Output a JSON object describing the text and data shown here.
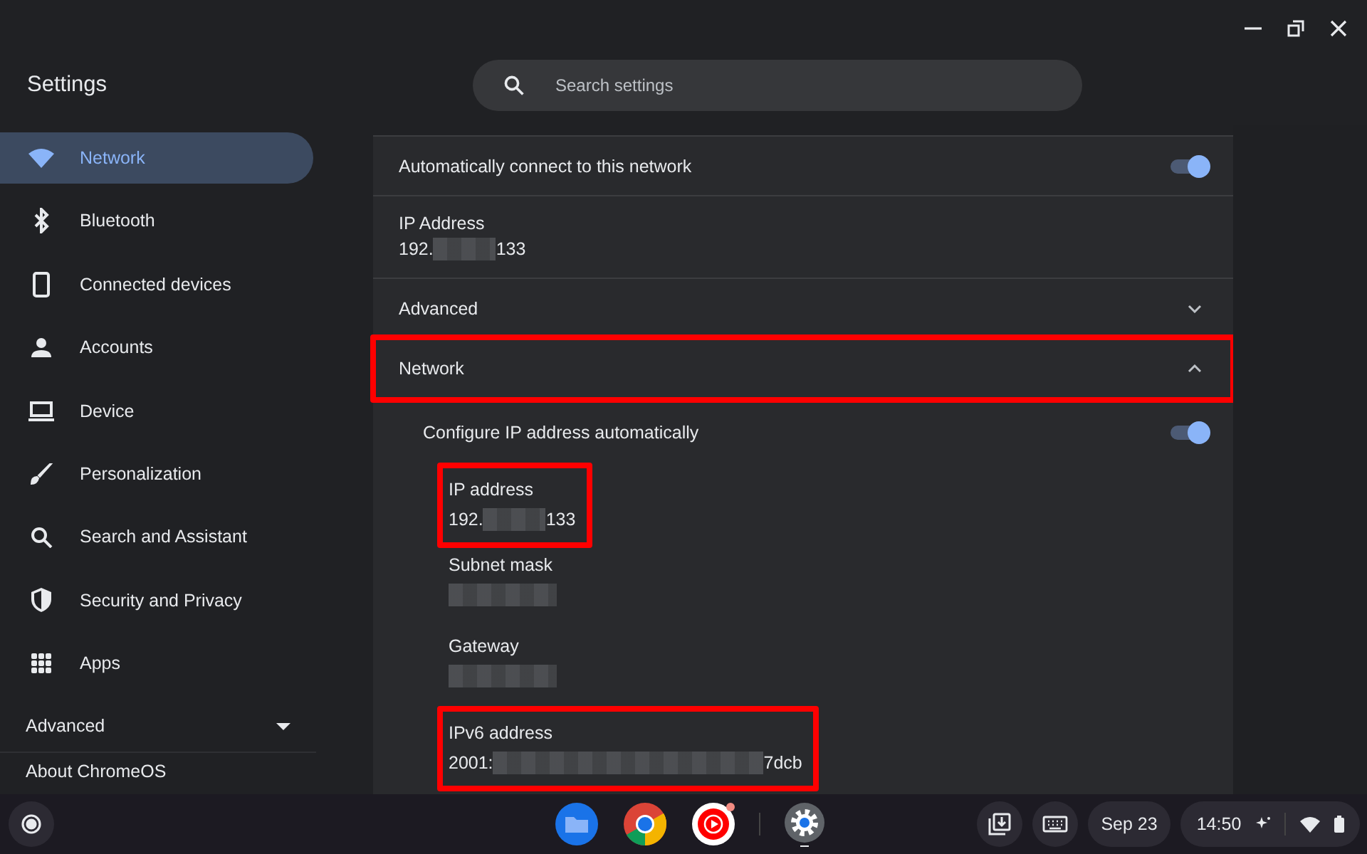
{
  "window": {
    "title": "Settings"
  },
  "search": {
    "placeholder": "Search settings"
  },
  "sidebar": {
    "items": [
      {
        "label": "Network",
        "selected": true
      },
      {
        "label": "Bluetooth",
        "selected": false
      },
      {
        "label": "Connected devices",
        "selected": false
      },
      {
        "label": "Accounts",
        "selected": false
      },
      {
        "label": "Device",
        "selected": false
      },
      {
        "label": "Personalization",
        "selected": false
      },
      {
        "label": "Search and Assistant",
        "selected": false
      },
      {
        "label": "Security and Privacy",
        "selected": false
      },
      {
        "label": "Apps",
        "selected": false
      }
    ],
    "advanced": {
      "label": "Advanced",
      "expanded": false
    },
    "about": "About ChromeOS"
  },
  "content": {
    "rows": [
      {
        "kind": "toggle",
        "label": "Automatically connect to this network",
        "on": true
      },
      {
        "kind": "value",
        "label": "IP Address",
        "value_start": "192.",
        "value_end": "133",
        "redacted": true
      },
      {
        "kind": "expander",
        "label": "Advanced",
        "expanded": false,
        "highlighted": false
      },
      {
        "kind": "expander",
        "label": "Network",
        "expanded": true,
        "highlighted": true
      }
    ],
    "network": {
      "toggle": {
        "label": "Configure IP address automatically",
        "on": true
      },
      "fields": [
        {
          "label": "IP address",
          "value_start": "192.",
          "value_end": "133",
          "redacted": true,
          "highlighted": true
        },
        {
          "label": "Subnet mask",
          "redacted": true,
          "highlighted": false
        },
        {
          "label": "Gateway",
          "redacted": true,
          "highlighted": false
        },
        {
          "label": "IPv6 address",
          "value_start": "2001:",
          "value_end": "7dcb",
          "redacted": true,
          "highlighted": true
        }
      ]
    }
  },
  "shelf": {
    "date": "Sep 23",
    "time": "14:50"
  }
}
